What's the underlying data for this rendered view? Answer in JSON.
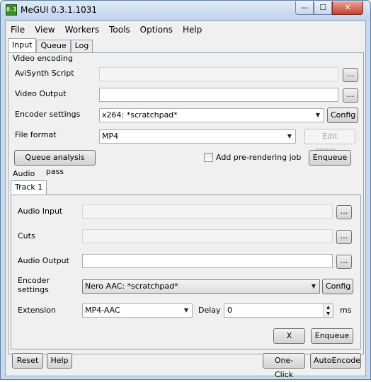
{
  "window": {
    "title": "MeGUI 0.3.1.1031",
    "icon": "megui-app-icon",
    "icon_text": "0.1",
    "controls": {
      "minimize": "—",
      "maximize": "☐",
      "close": "✕"
    }
  },
  "menu": [
    "File",
    "View",
    "Workers",
    "Tools",
    "Options",
    "Help"
  ],
  "tabs": [
    "Input",
    "Queue",
    "Log"
  ],
  "video": {
    "section_label": "Video encoding",
    "avisynth_label": "AviSynth Script",
    "avisynth_value": "",
    "output_label": "Video Output",
    "output_value": "",
    "encoder_label": "Encoder settings",
    "encoder_value": "x264: *scratchpad*",
    "config_label": "Config",
    "format_label": "File format",
    "format_value": "MP4",
    "edit_zones_label": "Edit zones...",
    "queue_analysis_label": "Queue analysis pass",
    "prerender_label": "Add pre-rendering job",
    "prerender_checked": false,
    "enqueue_label": "Enqueue",
    "browse_label": "..."
  },
  "audio": {
    "section_label": "Audio",
    "track_tab": "Track 1",
    "input_label": "Audio Input",
    "input_value": "",
    "cuts_label": "Cuts",
    "cuts_value": "",
    "output_label": "Audio Output",
    "output_value": "",
    "encoder_label_line1": "Encoder",
    "encoder_label_line2": "settings",
    "encoder_value": "Nero AAC: *scratchpad*",
    "config_label": "Config",
    "extension_label": "Extension",
    "extension_value": "MP4-AAC",
    "delay_label": "Delay",
    "delay_value": "0",
    "delay_unit": "ms",
    "remove_label": "X",
    "enqueue_label": "Enqueue",
    "browse_label": "..."
  },
  "bottom": {
    "reset_label": "Reset",
    "help_label": "Help",
    "oneclick_label": "One-Click",
    "autoencode_label": "AutoEncode"
  },
  "colors": {
    "titlebar": "#c9d9ed",
    "close_button": "#c4432d",
    "client_bg": "#f0f0f0"
  }
}
